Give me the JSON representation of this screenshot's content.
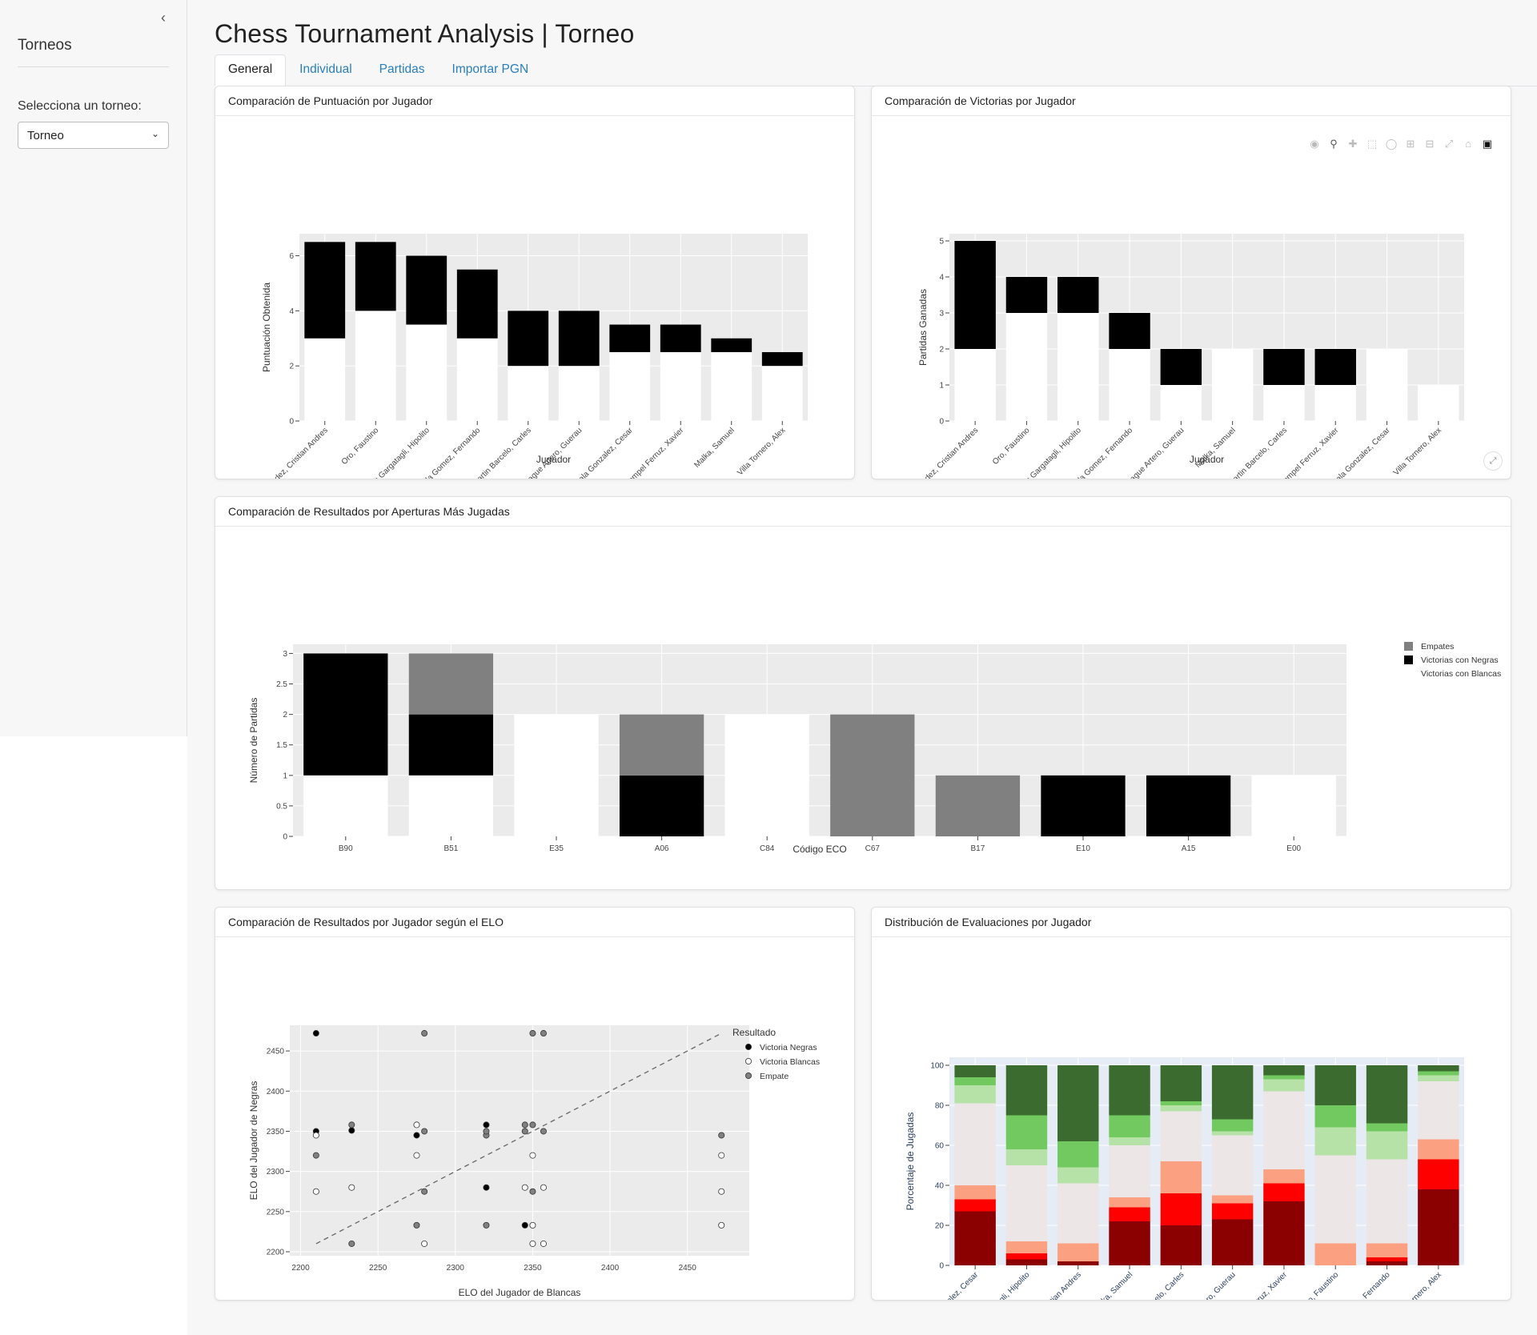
{
  "sidebar": {
    "title": "Torneos",
    "select_label": "Selecciona un torneo:",
    "select_value": "Torneo",
    "collapse_icon": "chevron-left-icon"
  },
  "page": {
    "title": "Chess Tournament Analysis | Torneo"
  },
  "tabs": [
    {
      "label": "General",
      "active": true
    },
    {
      "label": "Individual"
    },
    {
      "label": "Partidas"
    },
    {
      "label": "Importar PGN"
    }
  ],
  "cards": {
    "puntuacion": "Comparación de Puntuación por Jugador",
    "victorias": "Comparación de Victorias por Jugador",
    "aperturas": "Comparación de Resultados por Aperturas Más Jugadas",
    "elo": "Comparación de Resultados por Jugador según el ELO",
    "evaluaciones": "Distribución de Evaluaciones por Jugador"
  },
  "modebar_icons": [
    "camera-icon",
    "zoom-icon",
    "pan-icon",
    "box-select-icon",
    "lasso-icon",
    "zoom-in-icon",
    "zoom-out-icon",
    "autoscale-icon",
    "home-icon",
    "plotly-logo-icon"
  ],
  "colors": {
    "plot_bg": "#ebebeb",
    "win_white": "#ffffff",
    "win_black": "#000000",
    "draw": "#808080",
    "eval_bg": "#e5ecf6",
    "axis_blue": "#2a3f5f"
  },
  "chart_data": [
    {
      "id": "puntuacion",
      "type": "bar",
      "stacked": true,
      "xlabel": "Jugador",
      "ylabel": "Puntuación Obtenida",
      "ylim": [
        0,
        6.8
      ],
      "yticks": [
        0,
        2,
        4,
        6
      ],
      "categories": [
        "Hernandez, Cristian Andres",
        "Oro, Faustino",
        "Asis Gargatagli, Hipolito",
        "Valenzuela Gomez, Fernando",
        "Martin Barcelo, Carles",
        "Masague Artero, Guerau",
        "Alcala Gonzalez, Cesar",
        "Mompel Ferruz, Xavier",
        "Malka, Samuel",
        "Villa Tornero, Alex"
      ],
      "series": [
        {
          "color": "#ffffff",
          "values": [
            3,
            4,
            3.5,
            3,
            2,
            2,
            2.5,
            2.5,
            2.5,
            2
          ]
        },
        {
          "color": "#000000",
          "values": [
            3.5,
            2.5,
            2.5,
            2.5,
            2,
            2,
            1,
            1,
            0.5,
            0.5
          ]
        }
      ]
    },
    {
      "id": "victorias",
      "type": "bar",
      "stacked": true,
      "xlabel": "Jugador",
      "ylabel": "Partidas Ganadas",
      "ylim": [
        0,
        5.2
      ],
      "yticks": [
        0,
        1,
        2,
        3,
        4,
        5
      ],
      "categories": [
        "Hernandez, Cristian Andres",
        "Oro, Faustino",
        "Asis Gargatagli, Hipolito",
        "Valenzuela Gomez, Fernando",
        "Masague Artero, Guerau",
        "Malka, Samuel",
        "Martin Barcelo, Carles",
        "Mompel Ferruz, Xavier",
        "Alcala Gonzalez, Cesar",
        "Villa Tornero, Alex"
      ],
      "series": [
        {
          "color": "#ffffff",
          "values": [
            2,
            3,
            3,
            2,
            1,
            2,
            1,
            1,
            2,
            1
          ]
        },
        {
          "color": "#000000",
          "values": [
            3,
            1,
            1,
            1,
            1,
            0,
            1,
            1,
            0,
            0
          ]
        }
      ]
    },
    {
      "id": "aperturas",
      "type": "bar",
      "stacked": true,
      "xlabel": "Código ECO",
      "ylabel": "Número de Partidas",
      "ylim": [
        0,
        3.15
      ],
      "yticks": [
        0,
        0.5,
        1,
        1.5,
        2,
        2.5,
        3
      ],
      "categories": [
        "B90",
        "B51",
        "E35",
        "A06",
        "C84",
        "C67",
        "B17",
        "E10",
        "A15",
        "E00"
      ],
      "series": [
        {
          "name": "Victorias con Blancas",
          "color": "#ffffff",
          "values": [
            1,
            1,
            2,
            0,
            2,
            0,
            0,
            0,
            0,
            1
          ]
        },
        {
          "name": "Victorias con Negras",
          "color": "#000000",
          "values": [
            2,
            1,
            0,
            1,
            0,
            0,
            0,
            1,
            1,
            0
          ]
        },
        {
          "name": "Empates",
          "color": "#808080",
          "values": [
            0,
            1,
            0,
            1,
            0,
            2,
            1,
            0,
            0,
            0
          ]
        }
      ],
      "legend_order": [
        "Empates",
        "Victorias con Negras",
        "Victorias con Blancas"
      ]
    },
    {
      "id": "elo",
      "type": "scatter",
      "xlabel": "ELO del Jugador de Blancas",
      "ylabel": "ELO del Jugador de Negras",
      "xlim": [
        2193,
        2490
      ],
      "ylim": [
        2195,
        2482
      ],
      "xticks": [
        2200,
        2250,
        2300,
        2350,
        2400,
        2450
      ],
      "yticks": [
        2200,
        2250,
        2300,
        2350,
        2400,
        2450
      ],
      "legend_title": "Resultado",
      "trend": [
        [
          2210,
          2210
        ],
        [
          2472,
          2472
        ]
      ],
      "series": [
        {
          "name": "Victoria Negras",
          "color": "#000000",
          "points": [
            [
              2210,
              2472
            ],
            [
              2210,
              2350
            ],
            [
              2233,
              2351
            ],
            [
              2275,
              2345
            ],
            [
              2320,
              2358
            ],
            [
              2320,
              2280
            ],
            [
              2345,
              2233
            ]
          ]
        },
        {
          "name": "Victoria Blancas",
          "color": "#ffffff",
          "points": [
            [
              2210,
              2345
            ],
            [
              2210,
              2275
            ],
            [
              2233,
              2280
            ],
            [
              2275,
              2358
            ],
            [
              2275,
              2320
            ],
            [
              2280,
              2210
            ],
            [
              2345,
              2280
            ],
            [
              2350,
              2233
            ],
            [
              2350,
              2210
            ],
            [
              2350,
              2320
            ],
            [
              2357,
              2210
            ],
            [
              2357,
              2280
            ],
            [
              2472,
              2320
            ],
            [
              2472,
              2275
            ],
            [
              2472,
              2233
            ]
          ]
        },
        {
          "name": "Empate",
          "color": "#808080",
          "points": [
            [
              2210,
              2320
            ],
            [
              2233,
              2358
            ],
            [
              2233,
              2210
            ],
            [
              2275,
              2233
            ],
            [
              2280,
              2472
            ],
            [
              2280,
              2350
            ],
            [
              2280,
              2275
            ],
            [
              2320,
              2345
            ],
            [
              2320,
              2350
            ],
            [
              2320,
              2233
            ],
            [
              2345,
              2358
            ],
            [
              2345,
              2350
            ],
            [
              2350,
              2472
            ],
            [
              2350,
              2358
            ],
            [
              2350,
              2275
            ],
            [
              2357,
              2472
            ],
            [
              2357,
              2350
            ],
            [
              2472,
              2345
            ]
          ]
        }
      ]
    },
    {
      "id": "evaluaciones",
      "type": "bar",
      "stacked": true,
      "xlabel": "Jugador",
      "ylabel": "Porcentaje de Jugadas",
      "ylim": [
        0,
        104
      ],
      "yticks": [
        0,
        20,
        40,
        60,
        80,
        100
      ],
      "categories": [
        "Alcala Gonzalez, Cesar",
        "Asis Gargatagli, Hipolito",
        "Hernandez, Cristian Andres",
        "Malka, Samuel",
        "Martin Barcelo, Carles",
        "Masague Artero, Guerau",
        "Mompel Ferruz, Xavier",
        "Oro, Faustino",
        "Valenzuela Gomez, Fernando",
        "Villa Tornero, Alex"
      ],
      "series": [
        {
          "color": "#8b0000",
          "values": [
            27,
            3,
            2,
            22,
            20,
            23,
            32,
            0,
            2,
            38
          ]
        },
        {
          "color": "#ff0000",
          "values": [
            6,
            3,
            0,
            7,
            16,
            8,
            9,
            0,
            2,
            15
          ]
        },
        {
          "color": "#fca082",
          "values": [
            7,
            6,
            9,
            5,
            16,
            4,
            7,
            11,
            7,
            10
          ]
        },
        {
          "color": "#ece6e6",
          "values": [
            41,
            38,
            30,
            26,
            25,
            30,
            39,
            44,
            42,
            29
          ]
        },
        {
          "color": "#b6e2a8",
          "values": [
            9,
            8,
            8,
            4,
            3,
            2,
            6,
            14,
            14,
            3
          ]
        },
        {
          "color": "#71c960",
          "values": [
            4,
            17,
            13,
            11,
            2,
            6,
            2,
            11,
            4,
            2
          ]
        },
        {
          "color": "#3c6b2f",
          "values": [
            6,
            25,
            38,
            25,
            18,
            27,
            5,
            20,
            29,
            3
          ]
        }
      ]
    }
  ]
}
